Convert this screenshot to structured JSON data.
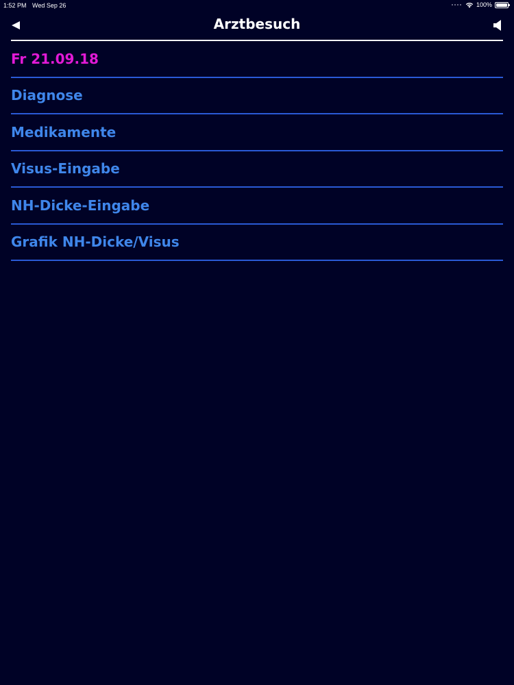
{
  "status_bar": {
    "time": "1:52 PM",
    "date": "Wed Sep 26",
    "battery": "100%",
    "battery_level": 1.0
  },
  "nav": {
    "title": "Arztbesuch",
    "back_icon": "triangle-left-icon",
    "speaker_icon": "speaker-icon"
  },
  "colors": {
    "background": "#000226",
    "date_text": "#e21ad6",
    "item_text": "#3f86ea",
    "divider": "#2a5ad6",
    "title_text": "#ffffff"
  },
  "list": {
    "date": "Fr 21.09.18",
    "items": [
      {
        "label": "Diagnose"
      },
      {
        "label": "Medikamente"
      },
      {
        "label": "Visus-Eingabe"
      },
      {
        "label": "NH-Dicke-Eingabe"
      },
      {
        "label": "Grafik NH-Dicke/Visus"
      }
    ]
  }
}
